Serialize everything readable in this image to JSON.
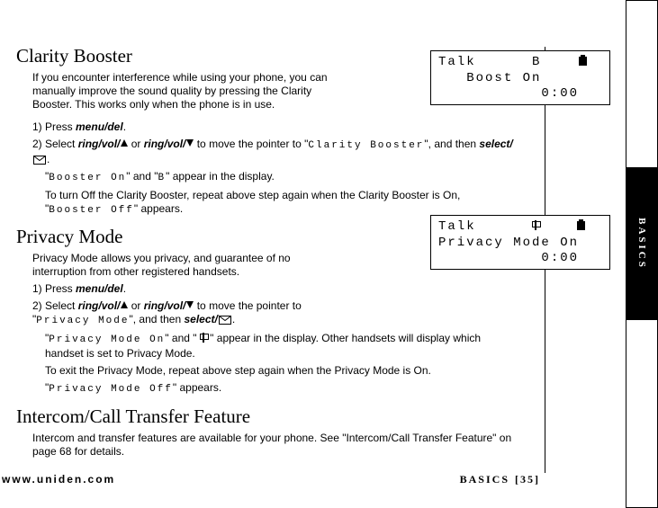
{
  "headings": {
    "clarity": "Clarity Booster",
    "privacy": "Privacy Mode",
    "intercom": "Intercom/Call Transfer Feature"
  },
  "clarity": {
    "intro": "If you encounter interference while using your phone, you can manually improve the sound quality by pressing the Clarity Booster. This works only when the phone is in use.",
    "step1_a": "1) Press ",
    "menu_del": "menu/del",
    "step2_a": "2) Select ",
    "ring_vol": "ring/vol/",
    "or": " or ",
    "step2_b": " to move the pointer to \"",
    "lcd_menu": "Clarity Booster",
    "step2_c": "\", and then ",
    "select": "select/",
    "booster_on": "Booster On",
    "sub_a2": "\" and \"",
    "B": "B",
    "sub_a3": "\" appear in the display.",
    "sub_b": "To turn Off the Clarity Booster, repeat above step again when the Clarity Booster is On, \"",
    "booster_off": "Booster Off",
    "sub_b2": "\" appears."
  },
  "privacy": {
    "intro": "Privacy Mode allows you privacy, and guarantee of no interruption from other registered handsets.",
    "step1_a": "1) Press ",
    "step2_a": "2) Select ",
    "step2_b": " to move the pointer to \"",
    "lcd_menu": "Privacy Mode",
    "step2_c": "\", and then ",
    "pm_on": "Privacy Mode On",
    "sub_a2": "\" and \" ",
    "sub_a3": " \" appear in the display. Other handsets will display which handset is set to Privacy Mode.",
    "sub_b": "To exit the Privacy Mode, repeat above step again when the Privacy Mode is On.",
    "pm_off": "Privacy Mode Off",
    "sub_c2": "\" appears."
  },
  "intercom": {
    "text": "Intercom and transfer features are available for your phone. See \"Intercom/Call Transfer Feature\" on page 68 for details."
  },
  "lcd1": {
    "l1a": "Talk",
    "l1b": "B",
    "l2": "Boost On",
    "l3": "0:00"
  },
  "lcd2": {
    "l1a": "Talk",
    "l2": "Privacy Mode On",
    "l3": "0:00"
  },
  "footer": {
    "url": "www.uniden.com",
    "section": "BASICS",
    "page": "[35]"
  },
  "tab": "BASICS"
}
